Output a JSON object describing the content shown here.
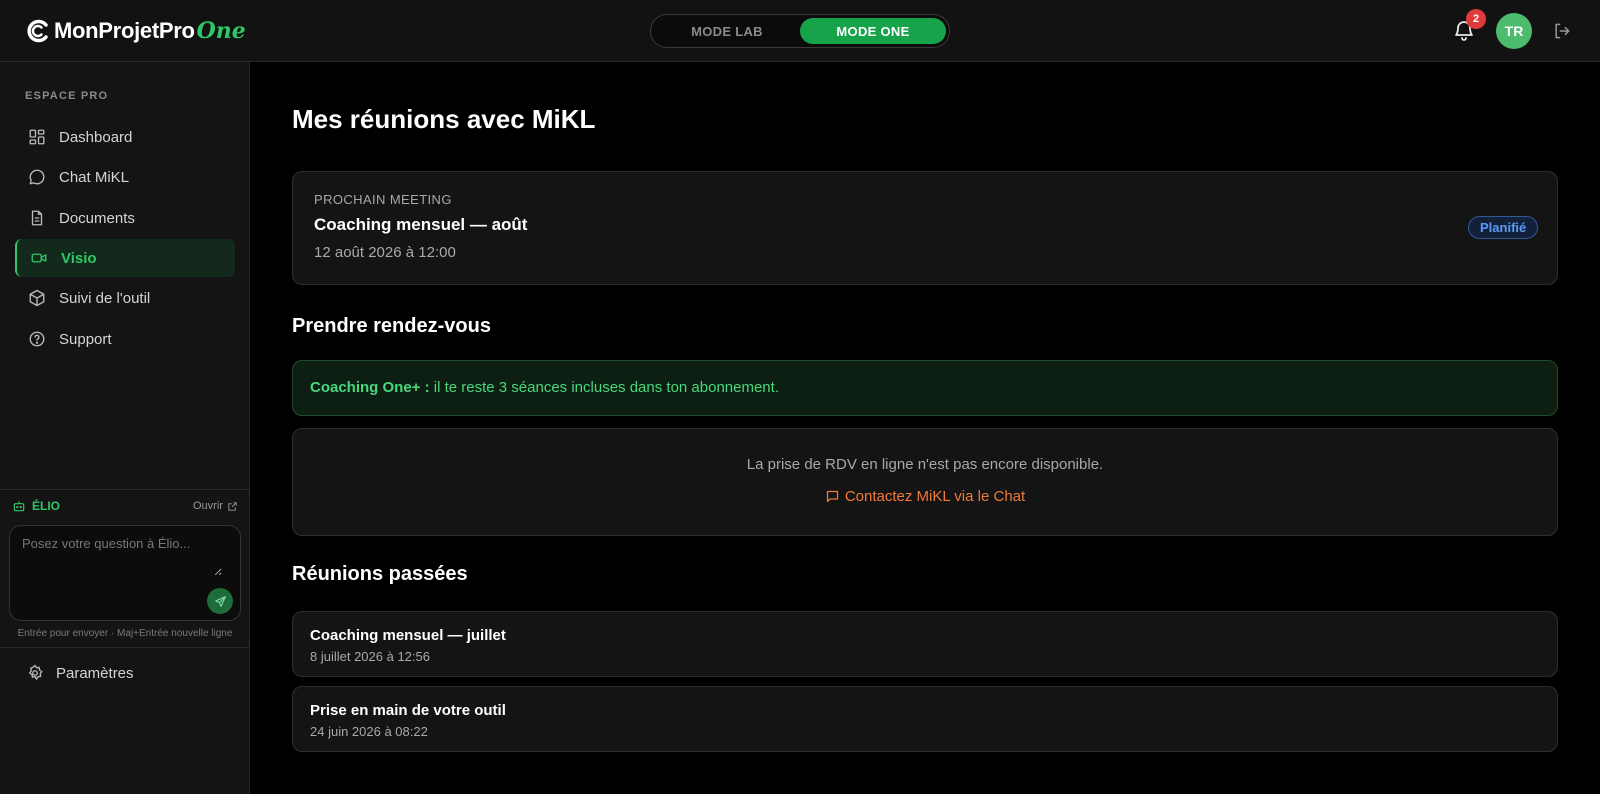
{
  "header": {
    "brand": "MonProjetPro",
    "brand_suffix": "One",
    "modes": [
      {
        "label": "MODE LAB",
        "active": false
      },
      {
        "label": "MODE ONE",
        "active": true
      }
    ],
    "notifications_count": "2",
    "avatar_initials": "TR",
    "icons": [
      "bell-icon",
      "logout-icon"
    ]
  },
  "sidebar": {
    "section_label": "ESPACE PRO",
    "items": [
      {
        "label": "Dashboard",
        "icon": "dashboard-icon",
        "active": false
      },
      {
        "label": "Chat MiKL",
        "icon": "chat-icon",
        "active": false
      },
      {
        "label": "Documents",
        "icon": "document-icon",
        "active": false
      },
      {
        "label": "Visio",
        "icon": "video-icon",
        "active": true
      },
      {
        "label": "Suivi de l'outil",
        "icon": "cube-icon",
        "active": false
      },
      {
        "label": "Support",
        "icon": "help-icon",
        "active": false
      }
    ],
    "elio": {
      "label": "ÉLIO",
      "open_label": "Ouvrir",
      "placeholder": "Posez votre question à Élio...",
      "hint": "Entrée pour envoyer · Maj+Entrée nouvelle ligne"
    },
    "settings_label": "Paramètres"
  },
  "main": {
    "title": "Mes réunions avec MiKL",
    "next_meeting": {
      "label": "PROCHAIN MEETING",
      "title": "Coaching mensuel — août",
      "date": "12 août 2026 à 12:00",
      "status": "Planifié"
    },
    "booking": {
      "title": "Prendre rendez-vous",
      "banner_bold": "Coaching One+ :",
      "banner_text": " il te reste 3 séances incluses dans ton abonnement.",
      "unavailable": "La prise de RDV en ligne n'est pas encore disponible.",
      "contact_link": "Contactez MiKL via le Chat"
    },
    "past": {
      "title": "Réunions passées",
      "meetings": [
        {
          "title": "Coaching mensuel — juillet",
          "date": "8 juillet 2026 à 12:56"
        },
        {
          "title": "Prise en main de votre outil",
          "date": "24 juin 2026 à 08:22"
        }
      ]
    }
  },
  "colors": {
    "accent": "#2ec866",
    "active_mode": "#16a34a",
    "badge_red": "#e03a3a",
    "link_orange": "#f07a3a",
    "status_blue": "#5a9cf5"
  }
}
